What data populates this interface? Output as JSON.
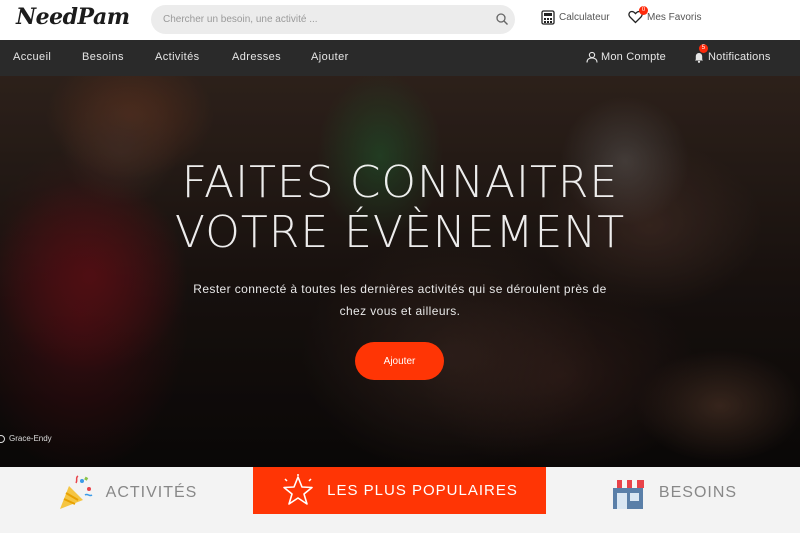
{
  "header": {
    "logo": "NeedPam",
    "search_placeholder": "Chercher un besoin, une activité ...",
    "calculator_label": "Calculateur",
    "favorites_label": "Mes Favoris",
    "favorites_count": "0"
  },
  "nav": {
    "items": [
      {
        "label": "Accueil"
      },
      {
        "label": "Besoins"
      },
      {
        "label": "Activités"
      },
      {
        "label": "Adresses"
      },
      {
        "label": "Ajouter"
      }
    ],
    "account_label": "Mon Compte",
    "notifications_label": "Notifications",
    "notifications_count": "5"
  },
  "hero": {
    "title_line1": "FAITES CONNAITRE",
    "title_line2": "VOTRE ÉVÈNEMENT",
    "subtitle": "Rester connecté à toutes les dernières activités qui se déroulent près de chez vous et ailleurs.",
    "button_label": "Ajouter",
    "photo_credit": "Grace-Endy"
  },
  "tabs": [
    {
      "label": "ACTIVITÉS",
      "icon": "party-popper-icon"
    },
    {
      "label": "LES PLUS POPULAIRES",
      "icon": "star-icon"
    },
    {
      "label": "BESOINS",
      "icon": "shop-icon"
    }
  ],
  "colors": {
    "accent": "#ff3505",
    "nav_bg": "#2a2a2a",
    "tabs_bg": "#f3f3f3"
  }
}
